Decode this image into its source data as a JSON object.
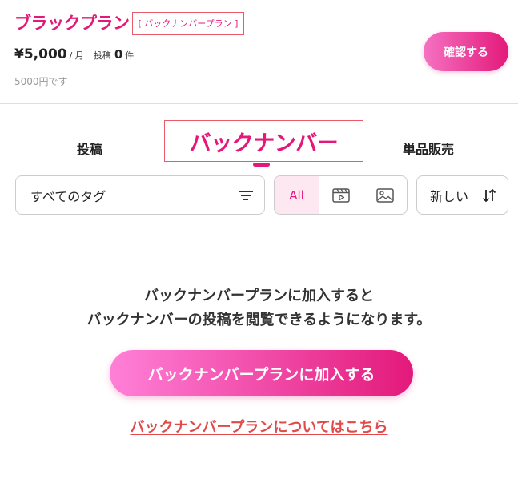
{
  "plan": {
    "name": "ブラックプラン",
    "tag": "[ バックナンバープラン ]",
    "price": "¥5,000",
    "price_unit": "/ 月",
    "post_label": "投稿",
    "post_count": "0",
    "post_unit": "件",
    "price_note": "5000円です",
    "confirm_label": "確認する"
  },
  "tabs": {
    "posts": "投稿",
    "backnumber": "バックナンバー",
    "single_sales": "単品販売",
    "active": "backnumber"
  },
  "filters": {
    "tag_select": "すべてのタグ",
    "type_options": [
      {
        "label": "All",
        "icon": "",
        "active": true
      },
      {
        "label": "",
        "icon": "video-icon",
        "active": false
      },
      {
        "label": "",
        "icon": "image-icon",
        "active": false
      }
    ],
    "sort": "新しい"
  },
  "message": {
    "line1": "バックナンバープランに加入すると",
    "line2": "バックナンバーの投稿を閲覧できるようになります。"
  },
  "join_button": "バックナンバープランに加入する",
  "about_link": "バックナンバープランについてはこちら",
  "colors": {
    "brand": "#e3197a",
    "highlight_border": "#ea5a6a",
    "link": "#e24a4a",
    "active_bg": "#fde8f1"
  }
}
